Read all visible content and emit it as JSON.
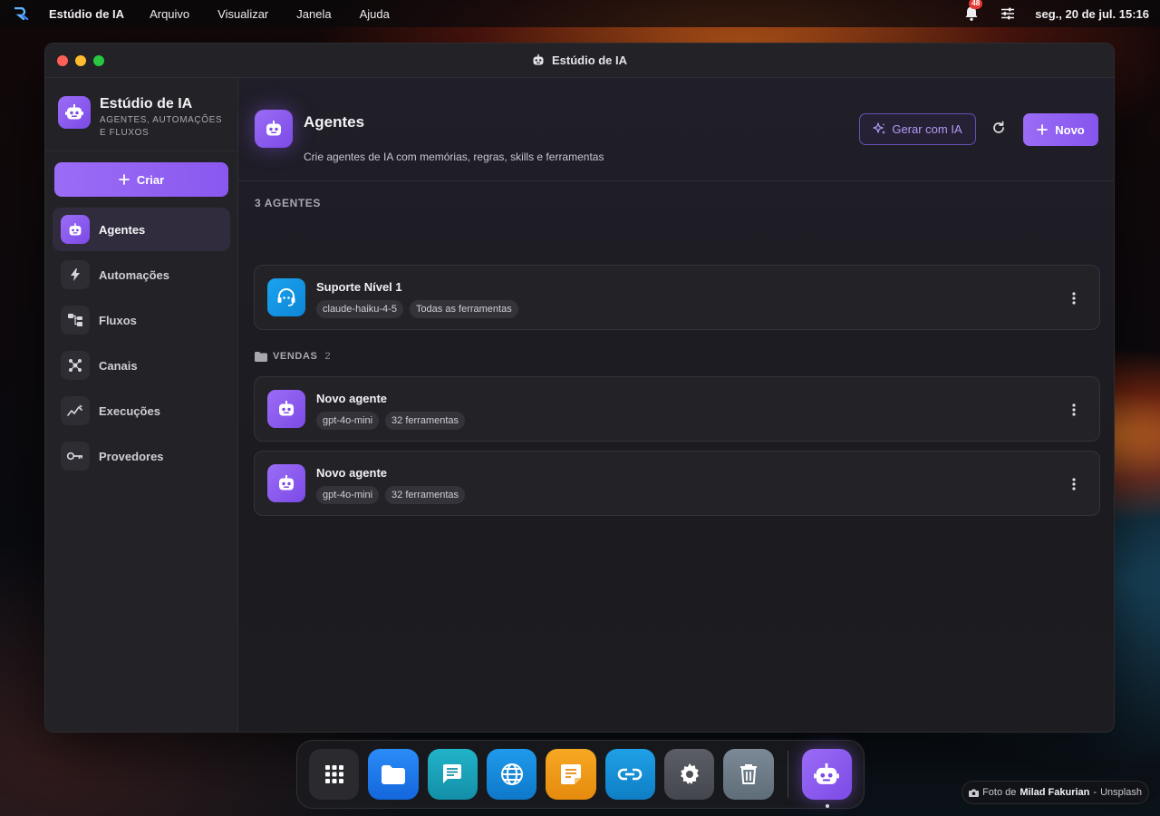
{
  "menubar": {
    "app_name": "Estúdio de IA",
    "menus": [
      "Arquivo",
      "Visualizar",
      "Janela",
      "Ajuda"
    ],
    "notification_count": "48",
    "clock": "seg., 20 de jul. 15:16"
  },
  "window": {
    "title": "Estúdio de IA"
  },
  "sidebar": {
    "brand_title": "Estúdio de IA",
    "brand_subtitle": "AGENTES, AUTOMAÇÕES E FLUXOS",
    "create_label": "Criar",
    "items": [
      {
        "label": "Agentes",
        "icon": "robot-icon",
        "active": true
      },
      {
        "label": "Automações",
        "icon": "bolt-icon"
      },
      {
        "label": "Fluxos",
        "icon": "flow-icon"
      },
      {
        "label": "Canais",
        "icon": "hub-icon"
      },
      {
        "label": "Execuções",
        "icon": "activity-icon"
      },
      {
        "label": "Provedores",
        "icon": "key-icon"
      }
    ]
  },
  "header": {
    "title": "Agentes",
    "description": "Crie agentes de IA com memórias, regras, skills e ferramentas",
    "generate_label": "Gerar com IA",
    "new_label": "Novo"
  },
  "list": {
    "count_label": "3 AGENTES",
    "ungrouped": [
      {
        "name": "Suporte Nível 1",
        "model": "claude-haiku-4-5",
        "tools": "Todas as ferramentas",
        "icon": "headset-icon"
      }
    ],
    "group": {
      "name": "VENDAS",
      "count": "2",
      "agents": [
        {
          "name": "Novo agente",
          "model": "gpt-4o-mini",
          "tools": "32 ferramentas",
          "icon": "robot-icon"
        },
        {
          "name": "Novo agente",
          "model": "gpt-4o-mini",
          "tools": "32 ferramentas",
          "icon": "robot-icon"
        }
      ]
    }
  },
  "dock": {
    "apps": [
      "apps-grid-icon",
      "folder-icon",
      "chat-icon",
      "globe-icon",
      "notes-icon",
      "link-icon",
      "settings-icon",
      "trash-icon",
      "robot-icon"
    ]
  },
  "credit": {
    "prefix": "Foto de",
    "author": "Milad Fakurian",
    "separator": "-",
    "source": "Unsplash"
  },
  "colors": {
    "accent": "#8b5cf6",
    "accent_blue": "#1aa3ef"
  }
}
